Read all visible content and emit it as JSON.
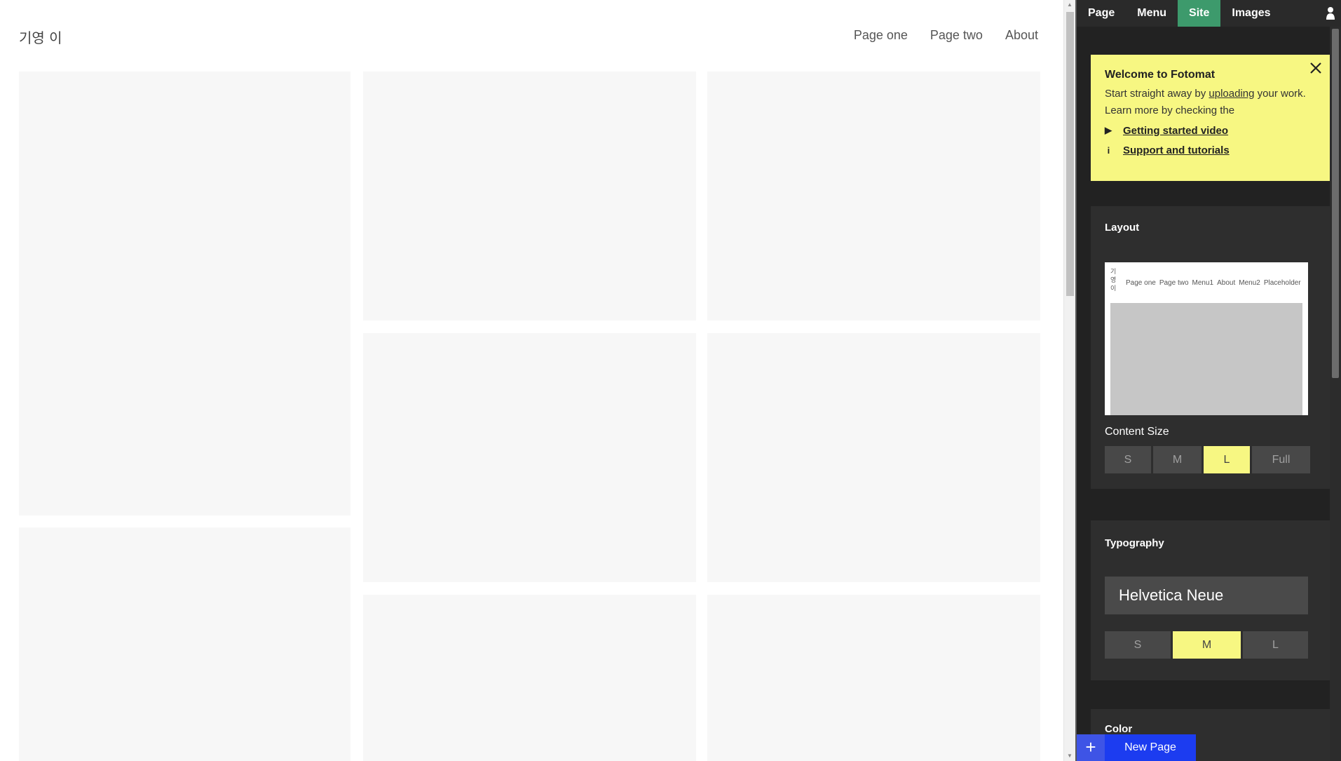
{
  "site": {
    "title": "기영 이",
    "nav": [
      "Page one",
      "Page two",
      "About"
    ]
  },
  "sidebar": {
    "tabs": [
      "Page",
      "Menu",
      "Site",
      "Images"
    ],
    "active_tab": "Site",
    "welcome": {
      "title": "Welcome to Fotomat",
      "body_prefix": "Start straight away by ",
      "body_link": "uploading",
      "body_suffix": " your work. Learn more by checking the",
      "video_link": "Getting started video",
      "support_link": "Support and tutorials"
    },
    "layout": {
      "title": "Layout",
      "preview_title": "기 영 이",
      "preview_nav": [
        "Page one",
        "Page two",
        "Menu1",
        "About",
        "Menu2",
        "Placeholder"
      ],
      "content_size_label": "Content Size",
      "content_size_options": [
        "S",
        "M",
        "L",
        "Full"
      ],
      "content_size_selected": "L"
    },
    "typography": {
      "title": "Typography",
      "font": "Helvetica Neue",
      "size_options": [
        "S",
        "M",
        "L"
      ],
      "size_selected": "M"
    },
    "color": {
      "title": "Color"
    },
    "new_page": {
      "plus": "+",
      "label": "New Page"
    }
  },
  "colors": {
    "accent_green": "#3d9a6c",
    "highlight_yellow": "#f7f782",
    "new_page_blue": "#1c3cf0"
  }
}
